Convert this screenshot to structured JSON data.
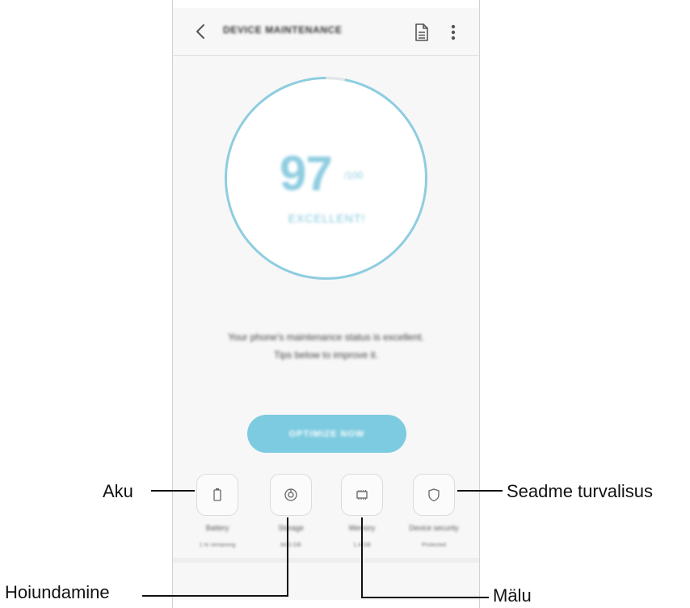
{
  "screen": {
    "appbar": {
      "title": "DEVICE MAINTENANCE",
      "back_icon": "chevron-left-icon",
      "report_icon": "document-icon",
      "more_icon": "more-vert-icon"
    },
    "score": {
      "value": "97",
      "unit": "/100",
      "status": "EXCELLENT!",
      "progress_fraction": 0.97,
      "ring_color": "#8ecde0"
    },
    "message": {
      "line1": "Your phone's maintenance status is excellent.",
      "line2": "Tips below to improve it."
    },
    "optimize_button": {
      "label": "OPTIMIZE NOW",
      "color": "#7ccbe0"
    },
    "tiles": [
      {
        "icon": "battery-icon",
        "label": "Battery",
        "sub": "1 hr remaining"
      },
      {
        "icon": "storage-icon",
        "label": "Storage",
        "sub": "64.0 GB"
      },
      {
        "icon": "memory-icon",
        "label": "Memory",
        "sub": "1.4 GB"
      },
      {
        "icon": "shield-icon",
        "label": "Device security",
        "sub": "Protected"
      }
    ]
  },
  "callouts": {
    "battery": "Aku",
    "storage": "Hoiundamine",
    "memory": "Mälu",
    "security": "Seadme turvalisus"
  }
}
